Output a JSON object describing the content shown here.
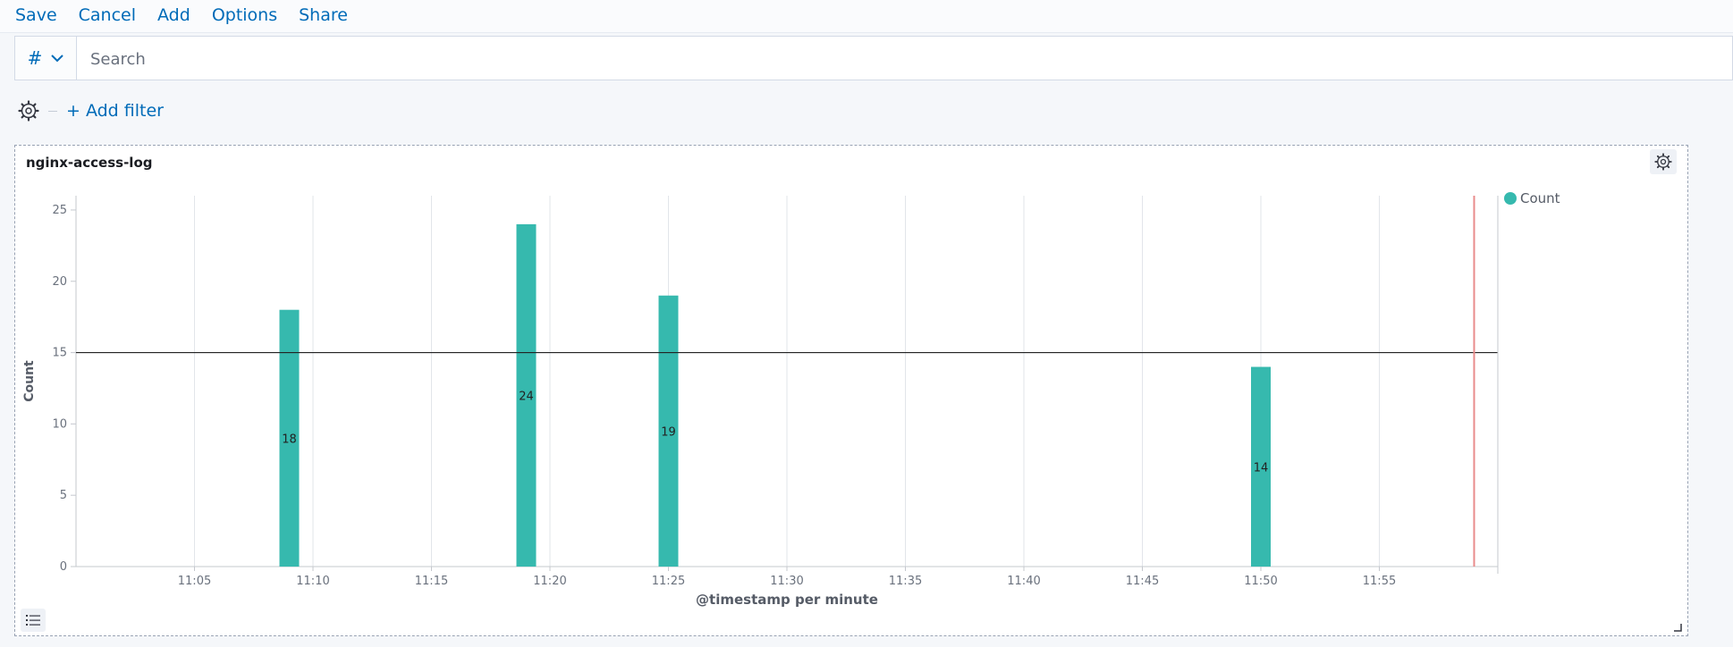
{
  "topnav": {
    "save_label": "Save",
    "cancel_label": "Cancel",
    "add_label": "Add",
    "options_label": "Options",
    "share_label": "Share"
  },
  "querybar": {
    "language_symbol": "#",
    "search_placeholder": "Search"
  },
  "filters": {
    "add_filter_label": "+ Add filter"
  },
  "panel": {
    "title": "nginx-access-log"
  },
  "colors": {
    "accent": "#006bb8",
    "bar": "#36b9ae",
    "threshold": "#222222",
    "current_time_marker": "#e88b8b"
  },
  "chart_data": {
    "type": "bar",
    "title": "nginx-access-log",
    "xlabel": "@timestamp per minute",
    "ylabel": "Count",
    "x_ticks": [
      "11:05",
      "11:10",
      "11:15",
      "11:20",
      "11:25",
      "11:30",
      "11:35",
      "11:40",
      "11:45",
      "11:50",
      "11:55"
    ],
    "x_range": [
      "11:00",
      "12:00"
    ],
    "y_ticks": [
      0,
      5,
      10,
      15,
      20,
      25
    ],
    "ylim": [
      0,
      26
    ],
    "series": [
      {
        "name": "Count",
        "points": [
          {
            "x": "11:09",
            "y": 18
          },
          {
            "x": "11:19",
            "y": 24
          },
          {
            "x": "11:25",
            "y": 19
          },
          {
            "x": "11:50",
            "y": 14
          }
        ]
      }
    ],
    "threshold_line": 15,
    "current_time_marker": "11:59",
    "grid": "vertical",
    "legend_position": "top-right",
    "data_labels": true
  }
}
